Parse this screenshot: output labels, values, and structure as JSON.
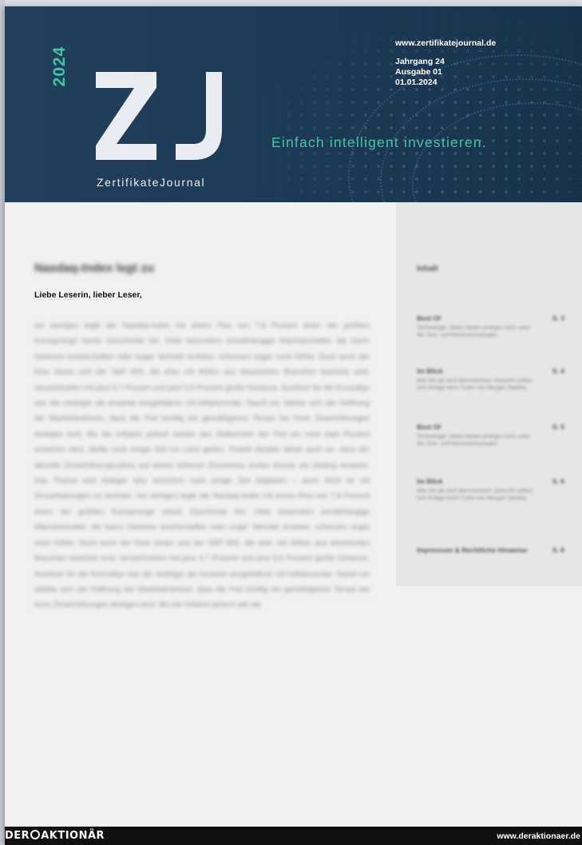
{
  "cover": {
    "year": "2024",
    "logo_letters": "ZJ",
    "logo_wordmark": "ZertifikateJournal",
    "website": "www.zertifikatejournal.de",
    "volume": "Jahrgang 24",
    "issue": "Ausgabe 01",
    "date": "01.01.2024",
    "slogan": "Einfach intelligent investieren.",
    "colors": {
      "header_bg": "#1d3b57",
      "accent": "#3fc7a3"
    }
  },
  "article": {
    "title": "Nasdaq-Index legt zu",
    "salutation": "Liebe Leserin, lieber Leser,",
    "body": "vor wenigen legte der Nasdaq-Index mit einem Plus von 7,6 Prozent einen der größten Kurssprünge seiner Geschichte hin. Viele besonders zinsabhängige Wachstumstitel, die kaum Gewinne erwirtschaften oder sogar Verluste erzielen, schossen sogar noch höher. Doch auch der Dow Jones und der S&P 500, die eher mit Aktien aus klassischen Branchen bestückt sind, verzeichneten mit plus 3,7 Prozent und plus 5,5 Prozent große Gewinne. Auslöser für die Kursrallye war die niedriger als erwartet ausgefallene US-Inflationsrate. Damit ver stärkte sich die Hoffnung der Marktteilnehmer, dass die Fed künftig ein gemäßigteres Tempo bei ihren Zinserhöhungen einlegen wird. Bis die Inflation jedoch wieder den Zielkorridor der Fed um rund zwei Prozent erreichen wird, dürfte noch einige Zeit ins Land gehen. Powell deutete daher auch an, dass der aktuelle Zinserhöhungszyklus auf einem höheren Zinsniveau enden könnte als bislang erwartet. Das Thema wird Anleger also sicherlich noch einige Zeit begleiten – auch 2023 ist mit Zinsanhebungen zu rechnen. Vor wenigen legte der Nasdaq-Index mit einem Plus von 7,6 Prozent einen der größten Kurssprünge seiner Geschichte hin. Viele besonders zinsabhängige Wachstumstitel, die kaum Gewinne erwirtschaften oder sogar Verluste erzielen, schossen sogar noch höher. Doch auch der Dow Jones und der S&P 500, die eher mit Aktien aus klassischen Branchen bestückt sind, verzeichneten mit plus 3,7 Prozent und plus 5,5 Prozent große Gewinne. Auslöser für die Kursrallye war die niedriger als erwartet ausgefallene US-Inflationsrate. Damit ver stärkte sich die Hoffnung der Marktteilnehmer, dass die Fed künftig ein gemäßigteres Tempo bei ihren Zinserhöhungen einlegen wird. Bis die Inflation jedoch wie der"
  },
  "toc": {
    "heading": "Inhalt",
    "items": [
      {
        "title": "Best Of",
        "page": "S. 3",
        "desc": "Technologie: Aktien bieten Anleger noch unter der Zins- und Rezessionssorgen."
      },
      {
        "title": "Im Blick",
        "page": "S. 4",
        "desc": "Wie Sie als wird übernommen: Gesucht sollten sich Anlage beim Turbo von Morgan Stanley."
      },
      {
        "title": "Best Of",
        "page": "S. 5",
        "desc": "Technologie: Aktien bieten Anleger noch unter der Zins- und Rezessionssorgen."
      },
      {
        "title": "Im Blick",
        "page": "S. 6",
        "desc": "Wie Sie als wird übernommen: Gesucht sollten sich Anlage beim Turbo von Morgan Stanley."
      },
      {
        "title": "Impressum & Rechtliche Hinweise",
        "page": "S. 8",
        "desc": ""
      }
    ]
  },
  "footer": {
    "brand_left": "DER",
    "brand_right": "AKTIONÄR",
    "url": "www.deraktionaer.de"
  }
}
